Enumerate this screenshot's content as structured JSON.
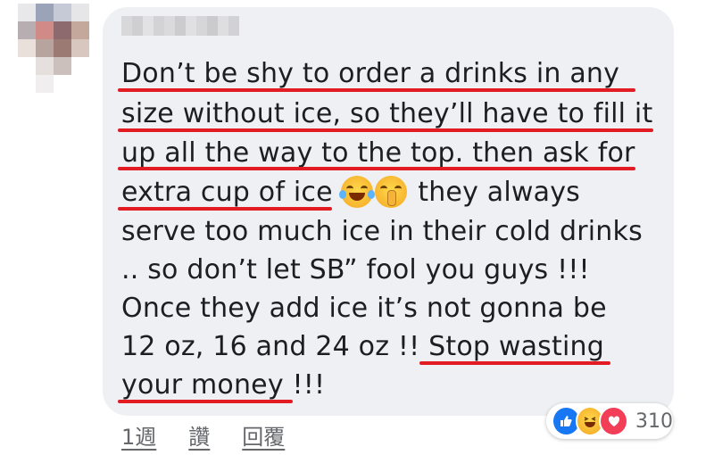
{
  "comment": {
    "lines": [
      "Don’t be shy to order a drinks  in any",
      "size without ice, so they’ll have to fill it",
      "up all the way to the top. then ask for",
      "extra cup of ice",
      "they always",
      "serve too much ice in their cold drinks",
      ".. so don’t let SB” fool you guys !!!",
      "Once they add ice it’s not gonna be",
      "12 oz, 16 and 24 oz !!",
      "Stop wasting",
      "your money",
      "!!!"
    ]
  },
  "actions": {
    "time": "1週",
    "like": "讚",
    "reply": "回覆"
  },
  "reactions": {
    "count": "310",
    "icons": [
      "like-icon",
      "haha-icon",
      "love-icon"
    ]
  },
  "colors": {
    "bubble": "#eef0f3",
    "underline": "#e31b23",
    "text": "#1c1e21",
    "meta": "#65676b"
  }
}
